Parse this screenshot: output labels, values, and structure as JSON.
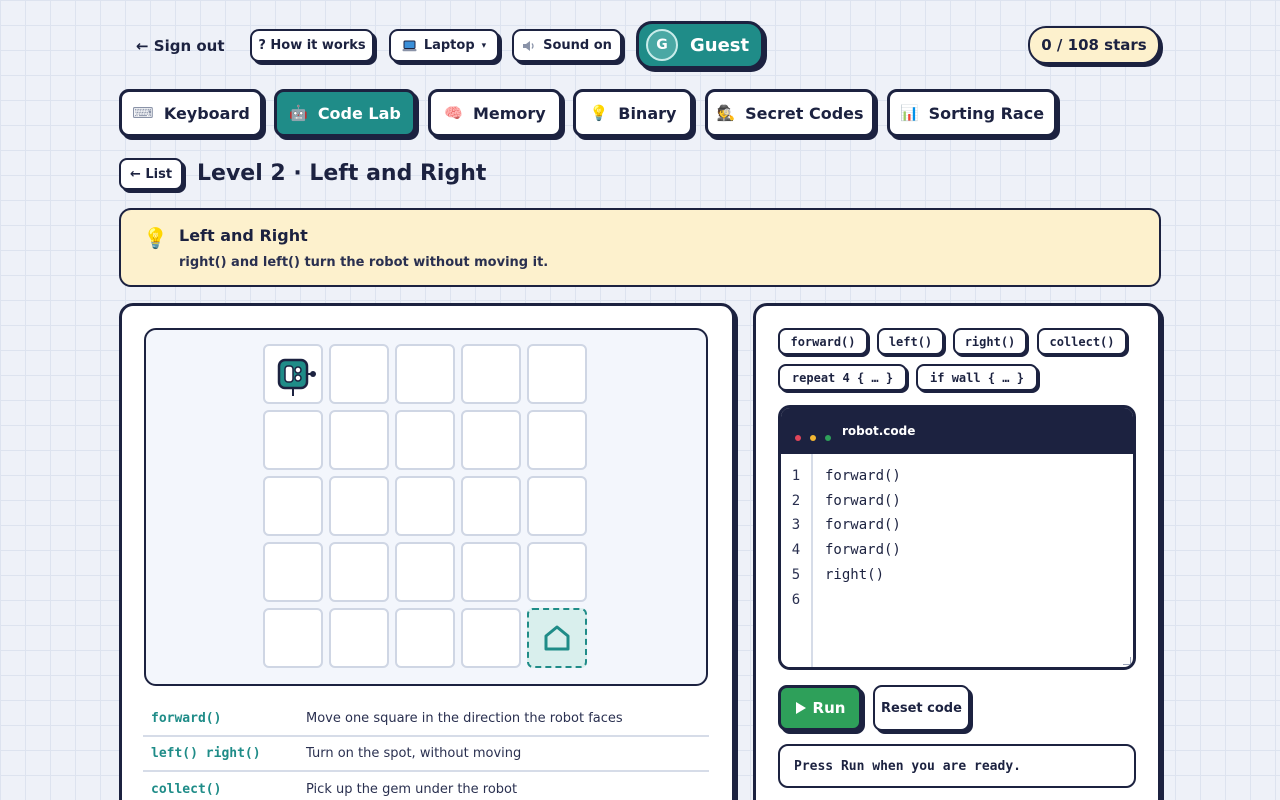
{
  "topbar": {
    "sign_out": "← Sign out",
    "how_it_works": "? How it works",
    "device_icon": "laptop-icon",
    "device": "Laptop",
    "device_caret": "▾",
    "sound_icon": "speaker-icon",
    "sound": "Sound on",
    "user_initial": "G",
    "user_name": "Guest",
    "stars": "0 / 108  stars"
  },
  "tabs": [
    {
      "label": "Keyboard",
      "icon": "keyboard-icon",
      "glyph": "⌨"
    },
    {
      "label": "Code Lab",
      "icon": "robot-icon",
      "glyph": "🤖"
    },
    {
      "label": "Memory",
      "icon": "brain-icon",
      "glyph": "🧠"
    },
    {
      "label": "Binary",
      "icon": "lightbulb-icon",
      "glyph": "💡"
    },
    {
      "label": "Secret Codes",
      "icon": "spy-icon",
      "glyph": "🕵"
    },
    {
      "label": "Sorting Race",
      "icon": "bar-chart-icon",
      "glyph": "📊"
    }
  ],
  "active_tab": "Code Lab",
  "level": {
    "back_label": "← List",
    "title": "Level 2 · Left and Right"
  },
  "hint": {
    "icon": "lightbulb-icon",
    "title": "Left and Right",
    "text": "right() and left() turn the robot without moving it."
  },
  "board": {
    "rows": 5,
    "cols": 5,
    "robot": {
      "row": 0,
      "col": 0,
      "facing": "right"
    },
    "goal": {
      "row": 4,
      "col": 4,
      "icon": "home-icon"
    }
  },
  "reference": [
    {
      "code": "forward()",
      "desc": "Move one square in the direction the robot faces"
    },
    {
      "code": "left() right()",
      "desc": "Turn on the spot, without moving"
    },
    {
      "code": "collect()",
      "desc": "Pick up the gem under the robot"
    }
  ],
  "chips": [
    "forward()",
    "left()",
    "right()",
    "collect()",
    "repeat 4 { … }",
    "if wall { … }"
  ],
  "editor": {
    "filename": "robot.code",
    "line_numbers": [
      "1",
      "2",
      "3",
      "4",
      "5",
      "6"
    ],
    "lines": [
      "forward()",
      "forward()",
      "forward()",
      "forward()",
      "right()",
      ""
    ],
    "dot_colors": [
      "#e0455a",
      "#f2b632",
      "#2ea05a"
    ]
  },
  "actions": {
    "run": "Run",
    "reset": "Reset code"
  },
  "status": "Press Run when you are ready.",
  "colors": {
    "ink": "#1c2240",
    "teal": "#1f8c88",
    "cream": "#fdf1cd",
    "run_green": "#2ea05a"
  }
}
